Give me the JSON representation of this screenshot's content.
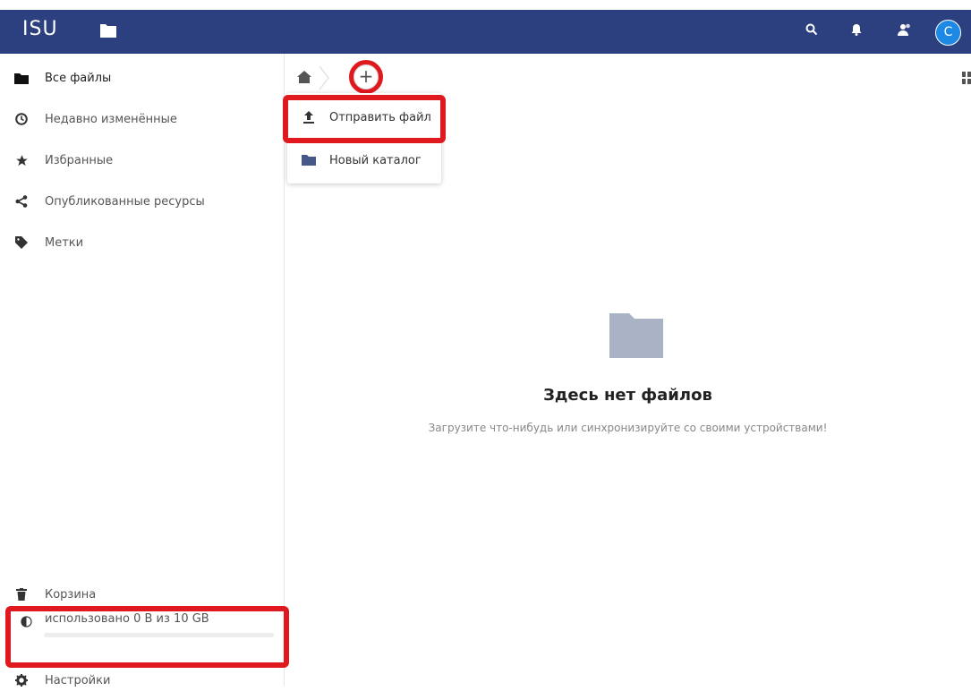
{
  "header": {
    "brand": "ISU",
    "avatar_letter": "C",
    "icons": [
      "folder-icon",
      "search-icon",
      "bell-icon",
      "contacts-icon"
    ],
    "colors": {
      "bar": "#2c3f7e",
      "avatar": "#1e88e5"
    }
  },
  "sidebar": {
    "items": [
      {
        "label": "Все файлы",
        "icon": "folder-icon"
      },
      {
        "label": "Недавно изменённые",
        "icon": "clock-icon"
      },
      {
        "label": "Избранные",
        "icon": "star-icon"
      },
      {
        "label": "Опубликованные ресурсы",
        "icon": "share-icon"
      },
      {
        "label": "Метки",
        "icon": "tag-icon"
      }
    ],
    "trash": {
      "label": "Корзина",
      "icon": "trash-icon"
    },
    "quota": {
      "label": "использовано 0 B из 10 GB",
      "fraction": 0.0,
      "icon": "pie-icon"
    },
    "settings": {
      "label": "Настройки",
      "icon": "gear-icon"
    }
  },
  "breadcrumb": {
    "home_icon": "home-icon",
    "add_label": "+"
  },
  "new_menu": {
    "items": [
      {
        "label": "Отправить файл",
        "icon": "upload-icon"
      },
      {
        "label": "Новый каталог",
        "icon": "folder-icon"
      }
    ]
  },
  "empty": {
    "title": "Здесь нет файлов",
    "subtitle": "Загрузите что-нибудь или синхронизируйте со своими устройствами!"
  },
  "highlight_color": "#e0191e"
}
